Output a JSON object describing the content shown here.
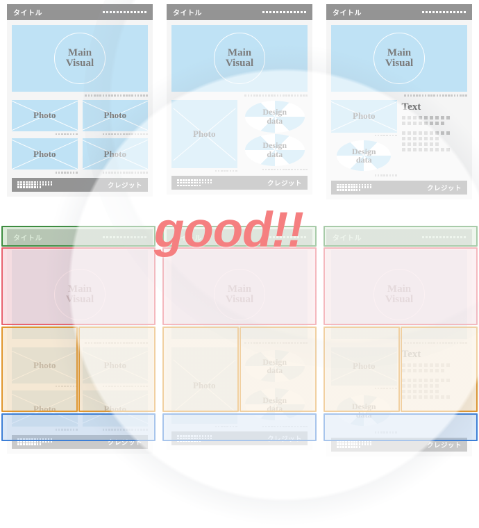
{
  "annotation": {
    "good_label": "good!!"
  },
  "colors": {
    "light_blue": "#bfe2f5",
    "bar_gray": "#949494",
    "page_bg": "#f5f5f5",
    "accent_pink": "#f57f80",
    "overlay_green": "#3d8c40",
    "overlay_red": "#e8636f",
    "overlay_orange": "#e0962e",
    "overlay_blue": "#3d7fd6"
  },
  "labels": {
    "title": "タイトル",
    "credit": "クレジット",
    "main_visual_line1": "Main",
    "main_visual_line2": "Visual",
    "photo": "Photo",
    "design_line1": "Design",
    "design_line2": "data",
    "text_heading": "Text"
  },
  "layouts": [
    {
      "id": "layout-1",
      "title": "タイトル",
      "main_visual": [
        "Main",
        "Visual"
      ],
      "blocks": [
        {
          "type": "photo",
          "label": "Photo"
        },
        {
          "type": "photo",
          "label": "Photo"
        },
        {
          "type": "photo",
          "label": "Photo"
        },
        {
          "type": "photo",
          "label": "Photo"
        }
      ],
      "credit": "クレジット"
    },
    {
      "id": "layout-2",
      "title": "タイトル",
      "main_visual": [
        "Main",
        "Visual"
      ],
      "blocks": [
        {
          "type": "photo",
          "label": "Photo"
        },
        {
          "type": "pie",
          "label": [
            "Design",
            "data"
          ]
        },
        {
          "type": "pie",
          "label": [
            "Design",
            "data"
          ]
        }
      ],
      "credit": "クレジット"
    },
    {
      "id": "layout-3",
      "title": "タイトル",
      "main_visual": [
        "Main",
        "Visual"
      ],
      "blocks": [
        {
          "type": "photo",
          "label": "Photo"
        },
        {
          "type": "pie",
          "label": [
            "Design",
            "data"
          ]
        },
        {
          "type": "text",
          "label": "Text"
        }
      ],
      "credit": "クレジット"
    }
  ],
  "annotated_layouts": [
    {
      "id": "annotated-layout-1",
      "regions": [
        {
          "name": "title-region",
          "color": "#3d8c40"
        },
        {
          "name": "main-visual-region",
          "color": "#e8636f"
        },
        {
          "name": "photo-region-left",
          "color": "#e0962e"
        },
        {
          "name": "photo-region-right",
          "color": "#e0962e"
        },
        {
          "name": "credit-region",
          "color": "#3d7fd6"
        }
      ]
    },
    {
      "id": "annotated-layout-2",
      "regions": [
        {
          "name": "title-region",
          "color": "#3d8c40"
        },
        {
          "name": "main-visual-region",
          "color": "#e8636f"
        },
        {
          "name": "photo-region-left",
          "color": "#e0962e"
        },
        {
          "name": "data-region-right",
          "color": "#e0962e"
        },
        {
          "name": "credit-region",
          "color": "#3d7fd6"
        }
      ]
    },
    {
      "id": "annotated-layout-3",
      "regions": [
        {
          "name": "title-region",
          "color": "#3d8c40"
        },
        {
          "name": "main-visual-region",
          "color": "#e8636f"
        },
        {
          "name": "media-region-left",
          "color": "#e0962e"
        },
        {
          "name": "text-region-right",
          "color": "#e0962e"
        },
        {
          "name": "credit-region",
          "color": "#3d7fd6"
        }
      ]
    }
  ]
}
